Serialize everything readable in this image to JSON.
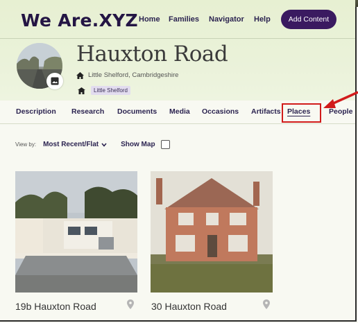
{
  "header": {
    "logo": "We Are.XYZ",
    "nav": [
      "Home",
      "Families",
      "Navigator",
      "Help"
    ],
    "add_button": "Add Content"
  },
  "profile": {
    "title": "Hauxton Road",
    "location": "Little Shelford, Cambridgeshire",
    "tag": "Little Shelford"
  },
  "tabs": [
    "Description",
    "Research",
    "Documents",
    "Media",
    "Occasions",
    "Artifacts",
    "Places",
    "People"
  ],
  "active_tab": "Places",
  "toolbar": {
    "view_by_label": "View by:",
    "view_by_value": "Most Recent/Flat",
    "show_map_label": "Show Map",
    "show_map_checked": false
  },
  "places": [
    {
      "name": "19b Hauxton Road"
    },
    {
      "name": "30 Hauxton Road"
    }
  ],
  "colors": {
    "brand": "#241544",
    "button": "#3a1a60",
    "highlight": "#d11b1b",
    "header_bg": "#e7f0d2"
  }
}
